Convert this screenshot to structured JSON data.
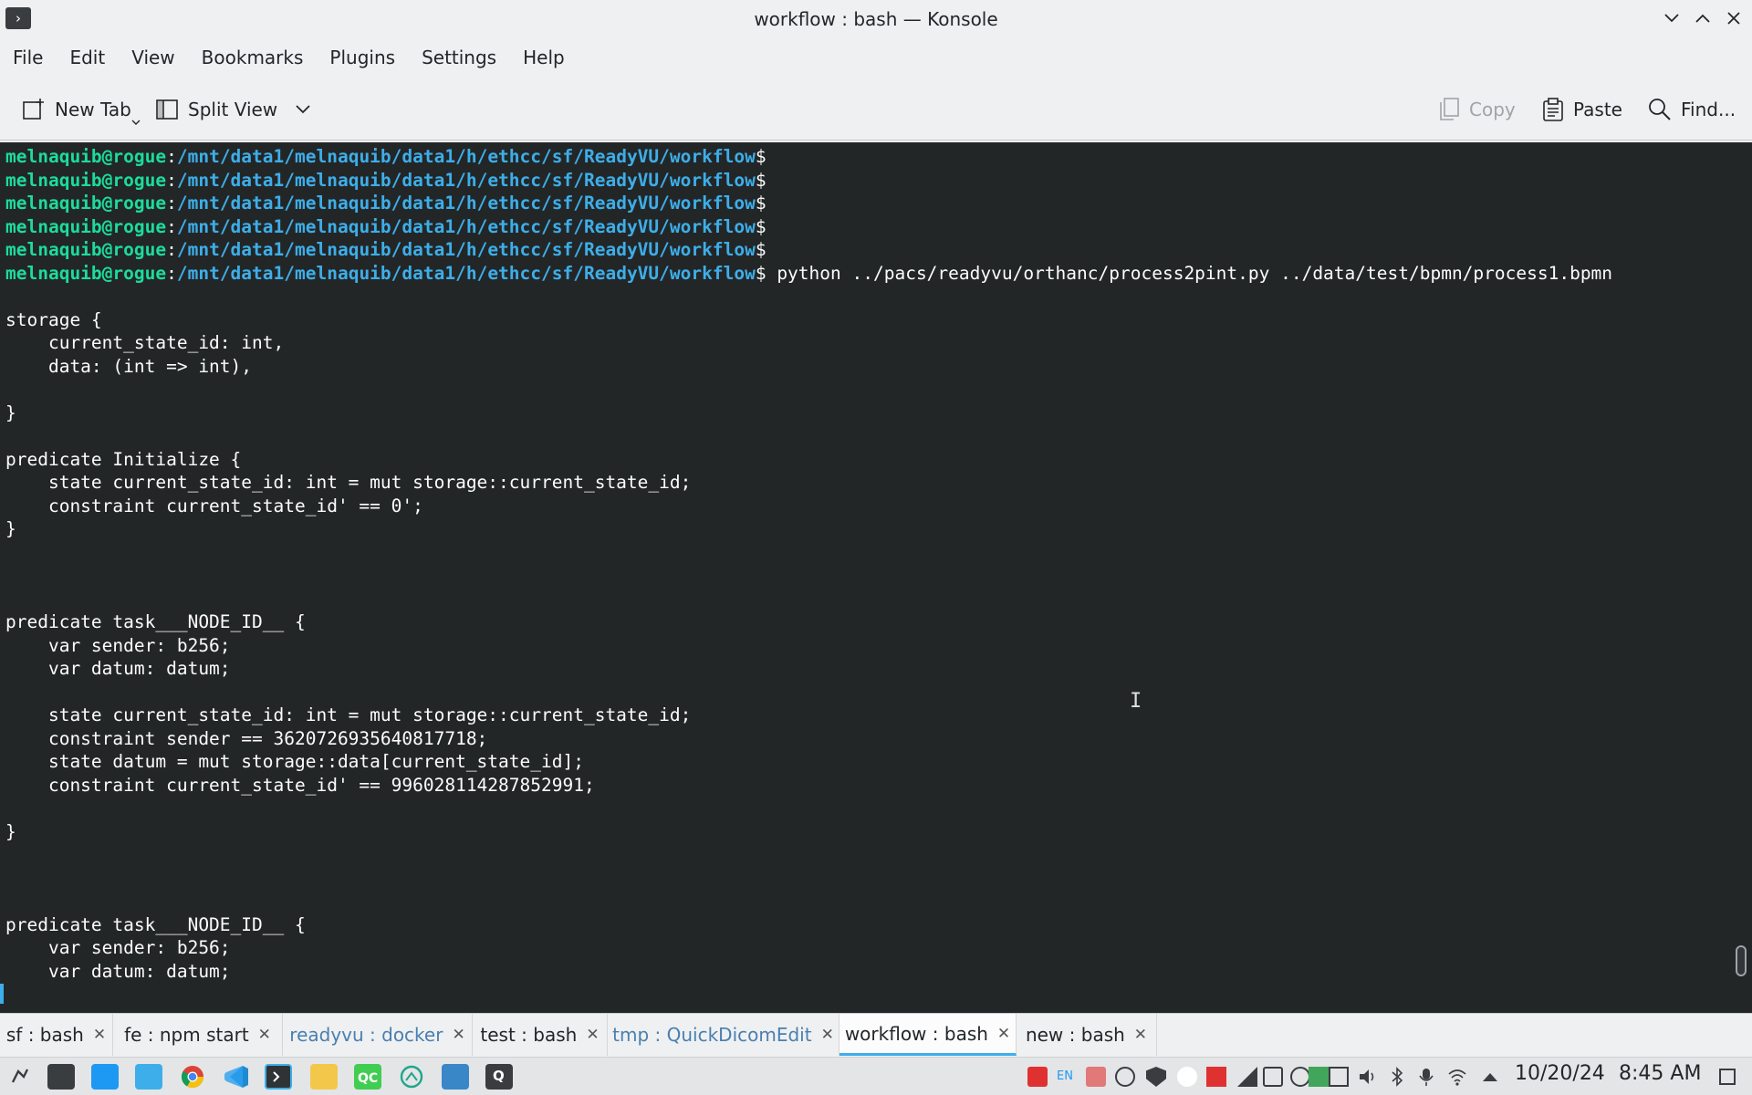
{
  "window": {
    "title": "workflow : bash — Konsole"
  },
  "menu": [
    "File",
    "Edit",
    "View",
    "Bookmarks",
    "Plugins",
    "Settings",
    "Help"
  ],
  "toolbar": {
    "new_tab": "New Tab",
    "split_view": "Split View",
    "copy": "Copy",
    "paste": "Paste",
    "find": "Find..."
  },
  "terminal": {
    "user": "melnaquib@rogue",
    "path": "/mnt/data1/melnaquib/data1/h/ethcc/sf/ReadyVU/workflow",
    "prompt_suffix": "$",
    "command": " python ../pacs/readyvu/orthanc/process2pint.py ../data/test/bpmn/process1.bpmn",
    "output": [
      "storage {",
      "    current_state_id: int,",
      "    data: (int => int),",
      "",
      "}",
      "",
      "predicate Initialize {",
      "    state current_state_id: int = mut storage::current_state_id;",
      "    constraint current_state_id' == 0';",
      "}",
      "",
      "",
      "",
      "predicate task___NODE_ID__ {",
      "    var sender: b256;",
      "    var datum: datum;",
      "",
      "    state current_state_id: int = mut storage::current_state_id;",
      "    constraint sender == 3620726935640817718;",
      "    state datum = mut storage::data[current_state_id];",
      "    constraint current_state_id' == 996028114287852991;",
      "",
      "}",
      "",
      "",
      "",
      "predicate task___NODE_ID__ {",
      "    var sender: b256;",
      "    var datum: datum;"
    ]
  },
  "tabs": [
    {
      "label": "sf : bash"
    },
    {
      "label": "fe : npm start"
    },
    {
      "label": "readyvu : docker"
    },
    {
      "label": "test : bash"
    },
    {
      "label": "tmp : QuickDicomEdit"
    },
    {
      "label": "workflow : bash"
    },
    {
      "label": "new : bash"
    }
  ],
  "taskbar": {
    "date": "10/20/24",
    "time": "8:45 AM",
    "tray_lang": "EN"
  },
  "colors": {
    "terminal_bg": "#232627",
    "user": "#1cdc9a",
    "path": "#3daee9",
    "accent": "#3daee9"
  }
}
